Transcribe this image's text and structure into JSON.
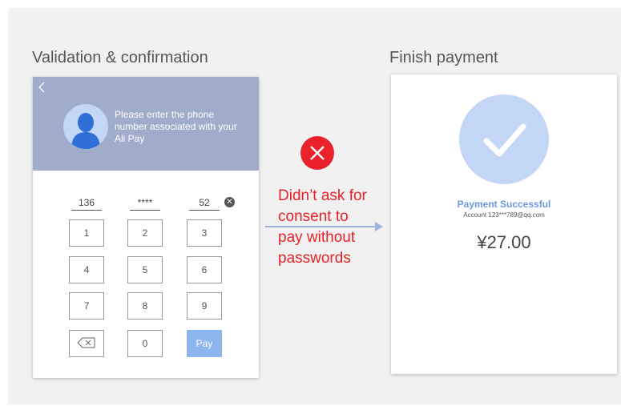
{
  "left_panel": {
    "heading": "Validation & confirmation",
    "prompt": "Please enter the phone number associated with your Ali Pay",
    "phone_segments": [
      "136",
      "****",
      "52"
    ],
    "keypad": {
      "keys": [
        "1",
        "2",
        "3",
        "4",
        "5",
        "6",
        "7",
        "8",
        "9"
      ],
      "zero": "0",
      "pay_label": "Pay"
    },
    "colors": {
      "header": "#9facca",
      "pay_button": "#8db6ee"
    }
  },
  "annotation": {
    "callout_lines": [
      "Didn’t ask for",
      "consent to",
      "pay without",
      "passwords"
    ],
    "colors": {
      "error": "#e8212a",
      "arrow": "#9fb3d6"
    },
    "icon": "error-x-icon"
  },
  "right_panel": {
    "heading": "Finish payment",
    "status": "Payment Successful",
    "account": "Account 123***789@qq.com",
    "amount": "¥27.00",
    "icon": "checkmark-icon"
  }
}
